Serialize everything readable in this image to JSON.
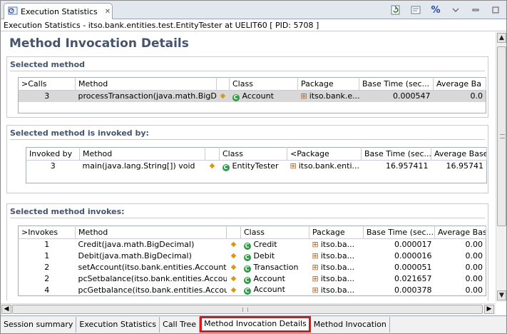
{
  "tab": {
    "title": "Execution Statistics",
    "close": "✕"
  },
  "toolbar": {
    "icons": [
      "refresh-icon",
      "filter-icon",
      "percent-icon",
      "view-menu-icon",
      "minimize-icon",
      "maximize-icon"
    ],
    "percent_label": "%"
  },
  "info_line": "Execution Statistics - itso.bank.entities.test.EntityTester at UELIT60 [ PID: 5708 ]",
  "page_title": "Method Invocation Details",
  "selected_method": {
    "title": "Selected method",
    "headers": [
      ">Calls",
      "Method",
      "",
      "Class",
      "Package",
      "Base Time (sec...",
      "Average Ba"
    ],
    "rows": [
      {
        "calls": "3",
        "method": "processTransaction(java.math.BigDe...",
        "class": "Account",
        "package": "itso.bank.e...",
        "base": "0.000547",
        "avg": "0.0"
      }
    ]
  },
  "invoked_by": {
    "title": "Selected method is invoked by:",
    "headers": [
      "Invoked by",
      "Method",
      "",
      "Class",
      "<Package",
      "Base Time (sec...",
      "Average Base ..."
    ],
    "rows": [
      {
        "count": "3",
        "method": "main(java.lang.String[]) void",
        "class": "EntityTester",
        "package": "itso.bank.enti...",
        "base": "16.957411",
        "avg": "16.95741"
      }
    ]
  },
  "invokes": {
    "title": "Selected method invokes:",
    "headers": [
      ">Invokes",
      "Method",
      "",
      "Class",
      "Package",
      "Base Time (sec...",
      "Average Base"
    ],
    "rows": [
      {
        "count": "1",
        "method": "Credit(java.math.BigDecimal)",
        "class": "Credit",
        "package": "itso.ba...",
        "base": "0.000017",
        "avg": "0.00"
      },
      {
        "count": "1",
        "method": "Debit(java.math.BigDecimal)",
        "class": "Debit",
        "package": "itso.ba...",
        "base": "0.000016",
        "avg": "0.00"
      },
      {
        "count": "2",
        "method": "setAccount(itso.bank.entities.Account) ...",
        "class": "Transaction",
        "package": "itso.ba...",
        "base": "0.000051",
        "avg": "0.00"
      },
      {
        "count": "2",
        "method": "pcSetbalance(itso.bank.entities.Accoun...",
        "class": "Account",
        "package": "itso.ba...",
        "base": "0.021657",
        "avg": "0.00"
      },
      {
        "count": "4",
        "method": "pcGetbalance(itso.bank.entities.Accoun...",
        "class": "Account",
        "package": "itso.ba...",
        "base": "0.000378",
        "avg": "0.00"
      }
    ]
  },
  "scroll": {
    "grip": "III",
    "up": "▲",
    "down": "▼",
    "left": "◀",
    "right": "▶"
  },
  "bottom_tabs": [
    "Session summary",
    "Execution Statistics",
    "Call Tree",
    "Method Invocation Details",
    "Method Invocation"
  ],
  "active_bottom_tab": "Method Invocation Details",
  "colors": {
    "title": "#45546d",
    "highlight_border": "#e01515",
    "class_icon": "#2f9a43",
    "package_icon": "#b5621c",
    "marker": "#d59a17"
  }
}
